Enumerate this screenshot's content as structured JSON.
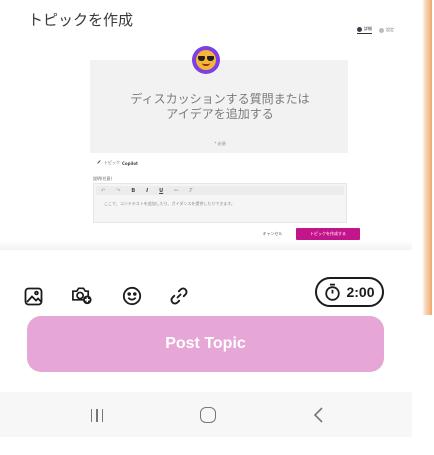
{
  "screenshot": {
    "title": "トピックを作成",
    "view_tabs": [
      {
        "label": "詳細",
        "active": true
      },
      {
        "label": "設定",
        "active": false
      }
    ],
    "cover": {
      "prompt": "ディスカッションする質問またはアイデアを追加する",
      "required": "* 必須"
    },
    "copilot": {
      "prefix": "トピック",
      "name": "Copilot"
    },
    "description": {
      "label": "説明(任意)",
      "toolbar": [
        "undo",
        "redo",
        "B",
        "I",
        "U",
        "link",
        "clear-format"
      ],
      "placeholder": "ここで、コンテキストを追加したり、ガイダンスを提供したりできます。"
    },
    "actions": {
      "cancel": "キャンセル",
      "create": "トピックを作成する"
    },
    "accent": "#c3158b"
  },
  "composer": {
    "tools": [
      "image-icon",
      "camera-plus-icon",
      "emoji-icon",
      "link-icon"
    ],
    "timer": {
      "icon": "stopwatch-icon",
      "value": "2:00"
    },
    "post_label": "Post Topic",
    "post_color": "#e6a7d7"
  },
  "system_nav": {
    "buttons": [
      "recents",
      "home",
      "back"
    ]
  }
}
